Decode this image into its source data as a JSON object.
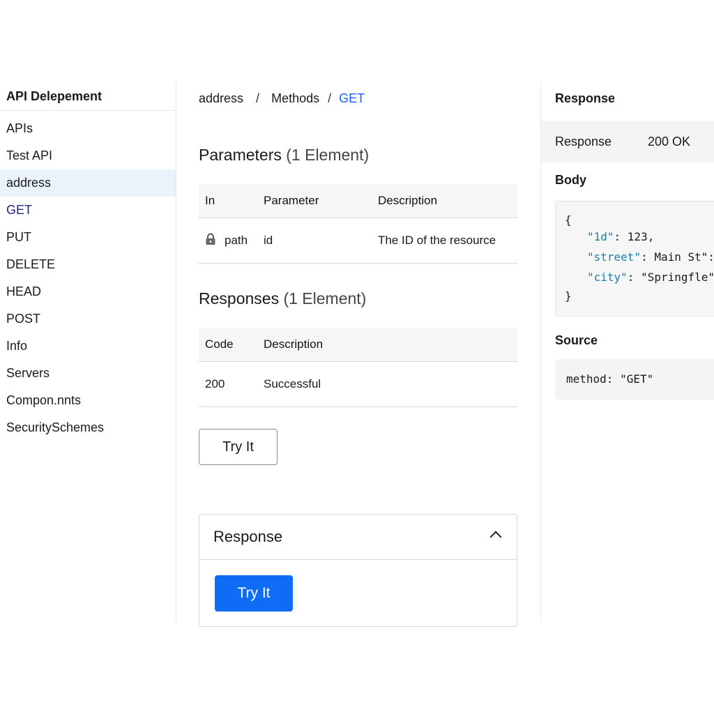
{
  "sidebar": {
    "title": "API Delepement",
    "items": [
      {
        "label": "APIs"
      },
      {
        "label": "Test API"
      },
      {
        "label": "address"
      },
      {
        "label": "GET"
      },
      {
        "label": "PUT"
      },
      {
        "label": "DELETE"
      },
      {
        "label": "HEAD"
      },
      {
        "label": "POST"
      },
      {
        "label": "Info"
      },
      {
        "label": "Servers"
      },
      {
        "label": "Compon.nnts"
      },
      {
        "label": "SecuritySchemes"
      }
    ],
    "active_item": "address"
  },
  "breadcrumb": {
    "items": [
      "address",
      "Methods",
      "GET"
    ],
    "separator": "/"
  },
  "parameters": {
    "title": "Parameters",
    "count_label": "(1 Element)",
    "columns": [
      "In",
      "Parameter",
      "Description"
    ],
    "rows": [
      {
        "in": "path",
        "in_icon": "lock-icon",
        "parameter": "id",
        "description": "The ID of the resource"
      }
    ]
  },
  "responses": {
    "title": "Responses",
    "count_label": "(1 Element)",
    "columns": [
      "Code",
      "Description"
    ],
    "rows": [
      {
        "code": "200",
        "description": "Successful"
      }
    ]
  },
  "try_it_button": {
    "label": "Try It"
  },
  "response_panel": {
    "title": "Response",
    "button_label": "Try It",
    "chevron_icon": "chevron-up-icon"
  },
  "right_panel": {
    "title": "Response",
    "status_label": "Response",
    "status_value": "200 OK",
    "body_label": "Body",
    "body_lines": [
      {
        "key": "",
        "rest": "{"
      },
      {
        "key": "\"1d\"",
        "rest": ": 123,"
      },
      {
        "key": "\"street\"",
        "rest": ": Main St\":"
      },
      {
        "key": "\"city\"",
        "rest": ": \"Springfle\""
      },
      {
        "key": "",
        "rest": "}"
      }
    ],
    "source_label": "Source",
    "source_code": "method: \"GET\""
  },
  "colors": {
    "accent_blue": "#0f6cf5",
    "link_blue": "#1a5cff",
    "active_bg": "#eaf3fc",
    "json_key": "#1a7fa8"
  }
}
